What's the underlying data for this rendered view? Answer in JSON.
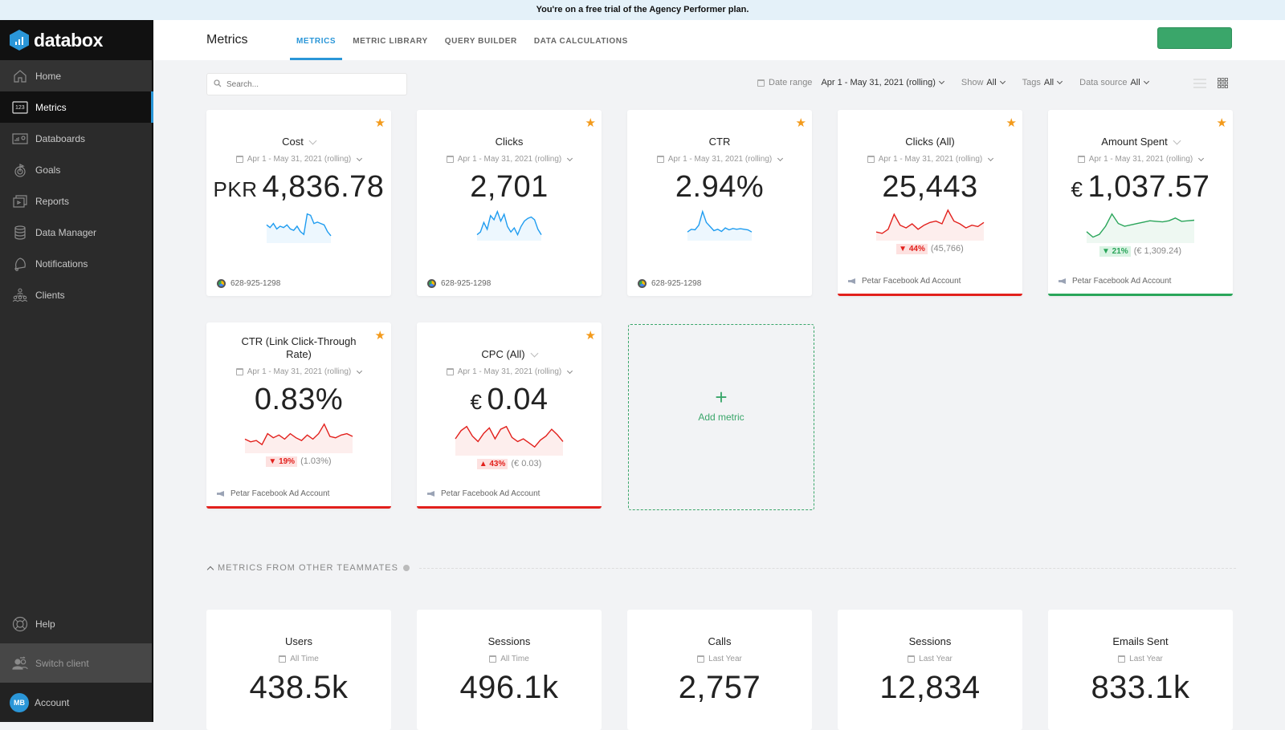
{
  "banner": "You're on a free trial of the Agency Performer plan.",
  "app": {
    "brand": "databox"
  },
  "sidebar": {
    "items": [
      {
        "label": "Home",
        "icon": "home-icon"
      },
      {
        "label": "Metrics",
        "icon": "metrics-123-icon"
      },
      {
        "label": "Databoards",
        "icon": "databoards-icon"
      },
      {
        "label": "Goals",
        "icon": "goals-target-icon"
      },
      {
        "label": "Reports",
        "icon": "reports-icon"
      },
      {
        "label": "Data Manager",
        "icon": "database-icon"
      },
      {
        "label": "Notifications",
        "icon": "bell-icon"
      },
      {
        "label": "Clients",
        "icon": "clients-icon"
      }
    ],
    "help": "Help",
    "switch_client": "Switch client",
    "account": "Account",
    "avatar_initials": "MB"
  },
  "header": {
    "title": "Metrics",
    "tabs": [
      {
        "label": "METRICS",
        "active": true
      },
      {
        "label": "METRIC LIBRARY",
        "active": false
      },
      {
        "label": "QUERY BUILDER",
        "active": false
      },
      {
        "label": "DATA CALCULATIONS",
        "active": false
      }
    ]
  },
  "toolbar": {
    "search_placeholder": "Search...",
    "date_range_label": "Date range",
    "date_range_value": "Apr 1 - May 31, 2021 (rolling)",
    "show_label": "Show",
    "show_value": "All",
    "tags_label": "Tags",
    "tags_value": "All",
    "datasource_label": "Data source",
    "datasource_value": "All"
  },
  "colors": {
    "accent": "#2a96d8",
    "positive": "#2aa55a",
    "negative": "#e2201c",
    "star": "#f39a1b",
    "spark_blue": "#1e9cf0"
  },
  "metrics": [
    {
      "title": "Cost",
      "has_dropdown": true,
      "date": "Apr 1 - May 31, 2021 (rolling)",
      "currency": "PKR",
      "value": "4,836.78",
      "spark_color": "#1e9cf0",
      "spark": [
        0.55,
        0.45,
        0.6,
        0.4,
        0.5,
        0.45,
        0.55,
        0.4,
        0.35,
        0.5,
        0.3,
        0.2,
        0.95,
        0.9,
        0.6,
        0.65,
        0.6,
        0.55,
        0.3,
        0.15
      ],
      "change": null,
      "compare": null,
      "source": "628-925-1298",
      "source_type": "google-ads",
      "status": "none"
    },
    {
      "title": "Clicks",
      "has_dropdown": false,
      "date": "Apr 1 - May 31, 2021 (rolling)",
      "currency": "",
      "value": "2,701",
      "spark_color": "#1e9cf0",
      "spark": [
        0.1,
        0.2,
        0.55,
        0.3,
        0.8,
        0.65,
        0.95,
        0.6,
        0.85,
        0.4,
        0.2,
        0.35,
        0.1,
        0.4,
        0.6,
        0.7,
        0.75,
        0.65,
        0.3,
        0.1
      ],
      "change": null,
      "compare": null,
      "source": "628-925-1298",
      "source_type": "google-ads",
      "status": "none"
    },
    {
      "title": "CTR",
      "has_dropdown": false,
      "date": "Apr 1 - May 31, 2021 (rolling)",
      "currency": "",
      "value": "2.94%",
      "spark_color": "#1e9cf0",
      "spark": [
        0.2,
        0.3,
        0.28,
        0.45,
        0.95,
        0.55,
        0.4,
        0.25,
        0.3,
        0.22,
        0.35,
        0.28,
        0.33,
        0.3,
        0.32,
        0.3,
        0.28,
        0.2
      ],
      "change": null,
      "compare": null,
      "source": "628-925-1298",
      "source_type": "google-ads",
      "status": "none"
    },
    {
      "title": "Clicks (All)",
      "has_dropdown": false,
      "date": "Apr 1 - May 31, 2021 (rolling)",
      "currency": "",
      "value": "25,443",
      "spark_color": "#e2201c",
      "spark": [
        0.2,
        0.15,
        0.3,
        0.85,
        0.45,
        0.35,
        0.5,
        0.3,
        0.45,
        0.55,
        0.6,
        0.5,
        1.0,
        0.6,
        0.5,
        0.35,
        0.45,
        0.4,
        0.55
      ],
      "change": {
        "direction": "down",
        "pct": "44%",
        "tone": "negative"
      },
      "compare": "(45,766)",
      "source": "Petar Facebook Ad Account",
      "source_type": "facebook-ads",
      "status": "negative"
    },
    {
      "title": "Amount Spent",
      "has_dropdown": true,
      "date": "Apr 1 - May 31, 2021 (rolling)",
      "currency": "€",
      "value": "1,037.57",
      "spark_color": "#2aa55a",
      "spark": [
        0.3,
        0.1,
        0.2,
        0.5,
        0.95,
        0.6,
        0.5,
        0.55,
        0.6,
        0.65,
        0.7,
        0.68,
        0.66,
        0.7,
        0.8,
        0.68,
        0.7,
        0.72
      ],
      "change": {
        "direction": "down",
        "pct": "21%",
        "tone": "positive"
      },
      "compare": "(€ 1,309.24)",
      "source": "Petar Facebook Ad Account",
      "source_type": "facebook-ads",
      "status": "positive"
    },
    {
      "title": "CTR (Link Click-Through Rate)",
      "has_dropdown": false,
      "date": "Apr 1 - May 31, 2021 (rolling)",
      "currency": "",
      "value": "0.83%",
      "spark_color": "#e2201c",
      "spark": [
        0.4,
        0.3,
        0.35,
        0.2,
        0.6,
        0.45,
        0.55,
        0.4,
        0.6,
        0.45,
        0.35,
        0.55,
        0.4,
        0.6,
        0.95,
        0.5,
        0.45,
        0.55,
        0.6,
        0.5
      ],
      "change": {
        "direction": "down",
        "pct": "19%",
        "tone": "negative"
      },
      "compare": "(1.03%)",
      "source": "Petar Facebook Ad Account",
      "source_type": "facebook-ads",
      "status": "negative"
    },
    {
      "title": "CPC (All)",
      "has_dropdown": true,
      "date": "Apr 1 - May 31, 2021 (rolling)",
      "currency": "€",
      "value": "0.04",
      "spark_color": "#e2201c",
      "spark": [
        0.5,
        0.8,
        0.95,
        0.6,
        0.4,
        0.7,
        0.9,
        0.5,
        0.85,
        0.95,
        0.55,
        0.4,
        0.5,
        0.35,
        0.2,
        0.45,
        0.6,
        0.85,
        0.65,
        0.4
      ],
      "change": {
        "direction": "up",
        "pct": "43%",
        "tone": "negative"
      },
      "compare": "(€ 0.03)",
      "source": "Petar Facebook Ad Account",
      "source_type": "facebook-ads",
      "status": "negative"
    }
  ],
  "add_metric": {
    "label": "Add metric"
  },
  "teammates_section": {
    "title": "METRICS FROM OTHER TEAMMATES"
  },
  "teammate_metrics": [
    {
      "title": "Users",
      "date": "All Time",
      "value": "438.5k"
    },
    {
      "title": "Sessions",
      "date": "All Time",
      "value": "496.1k"
    },
    {
      "title": "Calls",
      "date": "Last Year",
      "value": "2,757"
    },
    {
      "title": "Sessions",
      "date": "Last Year",
      "value": "12,834"
    },
    {
      "title": "Emails Sent",
      "date": "Last Year",
      "value": "833.1k"
    }
  ]
}
